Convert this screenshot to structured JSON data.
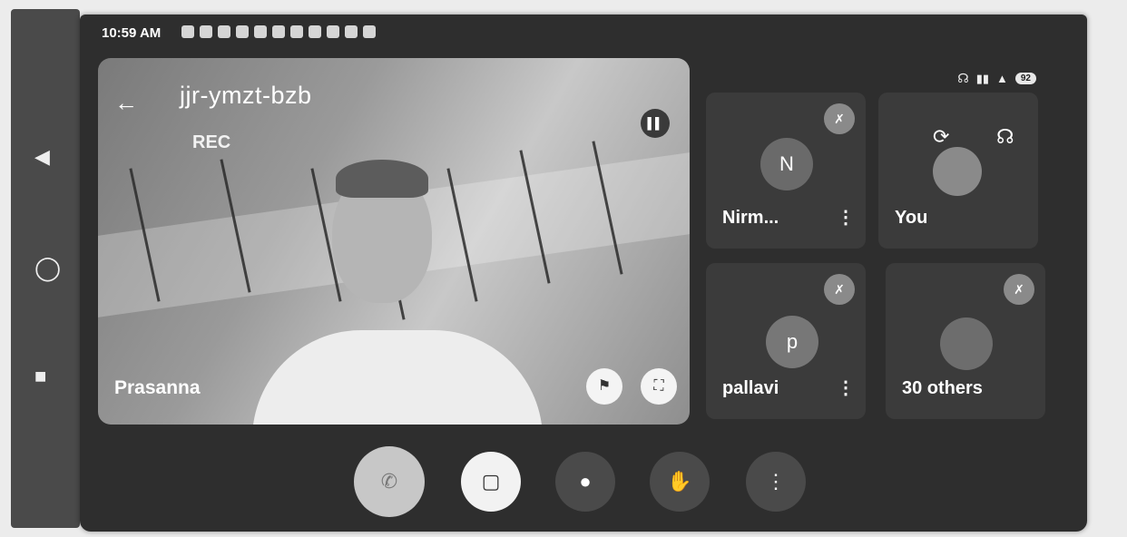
{
  "status_bar": {
    "time": "10:59 AM",
    "battery": "92"
  },
  "meeting": {
    "code": "jjr-ymzt-bzb",
    "recording_label": "REC"
  },
  "main_participant": {
    "name": "Prasanna"
  },
  "participants": [
    {
      "initial": "N",
      "name": "Nirm...",
      "avatar_color": "#6a6a6a",
      "muted": true
    },
    {
      "initial": "",
      "name": "You",
      "avatar_color": "#8a8a8a",
      "muted": false
    },
    {
      "initial": "p",
      "name": "pallavi",
      "avatar_color": "#777777",
      "muted": true
    },
    {
      "initial": "",
      "name": "30 others",
      "avatar_color": "#6d6d6d",
      "muted": true
    }
  ],
  "controls": [
    "end-call",
    "camera-off",
    "microphone",
    "raise-hand",
    "more-options"
  ]
}
